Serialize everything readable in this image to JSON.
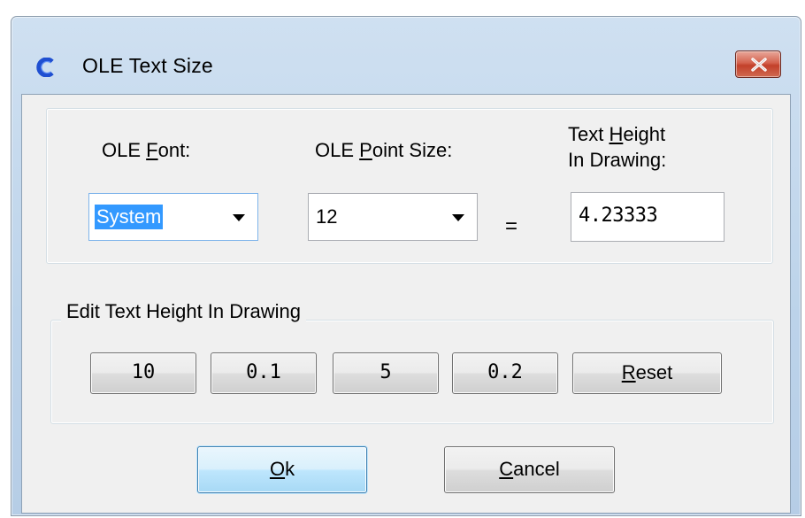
{
  "window": {
    "title": "OLE Text Size",
    "icon": "app-logo-icon",
    "close_icon": "close-icon"
  },
  "fields": {
    "font": {
      "label_pre": "OLE ",
      "label_key": "F",
      "label_post": "ont:",
      "value": "System"
    },
    "point_size": {
      "label_pre": "OLE ",
      "label_key": "P",
      "label_post": "oint Size:",
      "value": "12"
    },
    "equals": "=",
    "text_height": {
      "label1_pre": "Text ",
      "label1_key": "H",
      "label1_post": "eight",
      "label2": "In Drawing:",
      "value": "4.23333"
    }
  },
  "edit_group": {
    "label": "Edit Text Height In Drawing",
    "buttons": [
      "10",
      "0.1",
      "5",
      "0.2"
    ],
    "reset_key": "R",
    "reset_rest": "eset"
  },
  "actions": {
    "ok_key": "O",
    "ok_rest": "k",
    "cancel_key": "C",
    "cancel_rest": "ancel"
  },
  "colors": {
    "selection": "#3399ff",
    "close_button": "#c2402a",
    "default_button_border": "#3c7fb1"
  }
}
